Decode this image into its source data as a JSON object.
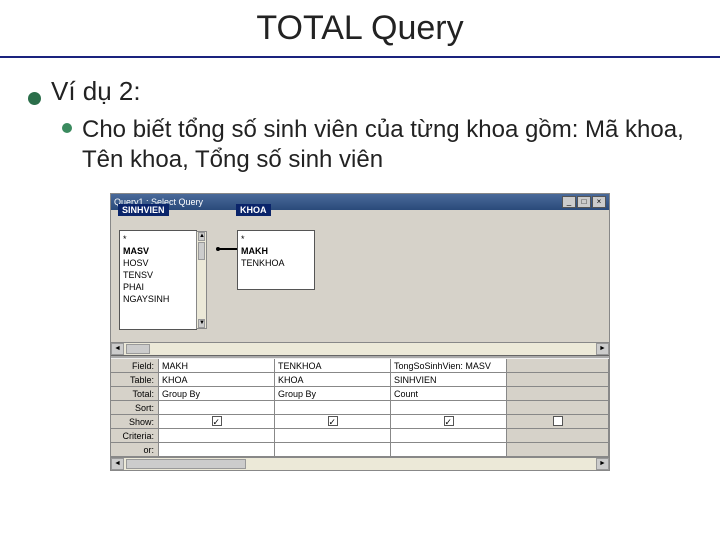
{
  "slide": {
    "title": "TOTAL Query",
    "bullet1": "Ví dụ 2:",
    "bullet2": "Cho biết tổng số sinh viên của từng khoa gồm: Mã khoa, Tên khoa, Tổng số sinh viên"
  },
  "window": {
    "title": "Query1 : Select Query",
    "tables": {
      "sinhvien": {
        "name": "SINHVIEN",
        "fields": [
          "*",
          "MASV",
          "HOSV",
          "TENSV",
          "PHAI",
          "NGAYSINH"
        ]
      },
      "khoa": {
        "name": "KHOA",
        "fields": [
          "*",
          "MAKH",
          "TENKHOA"
        ]
      }
    },
    "grid": {
      "rows": [
        "Field:",
        "Table:",
        "Total:",
        "Sort:",
        "Show:",
        "Criteria:",
        "or:"
      ],
      "cols": [
        {
          "field": "MAKH",
          "table": "KHOA",
          "total": "Group By",
          "show": true
        },
        {
          "field": "TENKHOA",
          "table": "KHOA",
          "total": "Group By",
          "show": true
        },
        {
          "field": "TongSoSinhVien: MASV",
          "table": "SINHVIEN",
          "total": "Count",
          "show": true
        }
      ]
    }
  }
}
